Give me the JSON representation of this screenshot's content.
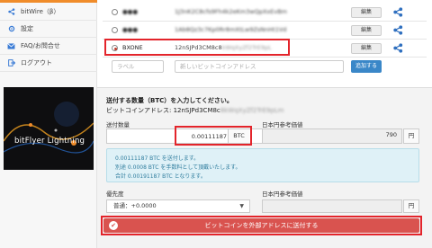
{
  "sidebar": {
    "items": [
      {
        "label": "bitWire（β）",
        "icon": "share-icon"
      },
      {
        "label": "設定",
        "icon": "gear-icon"
      },
      {
        "label": "FAQ/お問合せ",
        "icon": "mail-icon"
      },
      {
        "label": "ログアウト",
        "icon": "logout-icon"
      }
    ],
    "banner_text": "bitFlyer Lightning"
  },
  "address_book": {
    "rows": [
      {
        "label": "●●●",
        "address": "1J3nK2C8cfs9Fh4k2eKm3wQpXxEvBm",
        "edit_label": "編集",
        "selected": false
      },
      {
        "label": "●●●",
        "address": "1Ab8Qz3c7Kp0Rr8mXtLw9ZsNnHt1Vd",
        "edit_label": "編集",
        "selected": false
      },
      {
        "label": "BXONE",
        "address": "12nSJPd3CM8c8",
        "address_blurred": "kWqXyZf2TrE9pL",
        "edit_label": "編集",
        "selected": true
      }
    ],
    "new_label_placeholder": "ラベル",
    "new_address_placeholder": "新しいビットコインアドレス",
    "add_button": "追加する"
  },
  "send": {
    "title": "送付する数量（BTC）を入力してください。",
    "address_line_prefix": "ビットコインアドレス: 12nSJPd3CM8c",
    "address_line_blurred": "8kWqXyZf2TrE9pLm",
    "amount_label": "送付数量",
    "amount_value": "0.00111187",
    "amount_unit": "BTC",
    "jpy_label": "日本円参考価値",
    "jpy_value": "790",
    "jpy_unit": "円",
    "info_lines": [
      "0.00111187 BTC を送付します。",
      "別途 0.0008 BTC を手数料として頂戴いたします。",
      "合計 0.00191187 BTC となります。"
    ],
    "priority_label": "優先度",
    "priority_value": "普通：+0.0000",
    "fee_label": "日本円参考価値",
    "fee_unit": "円",
    "send_button": "ビットコインを外部アドレスに送付する"
  },
  "colors": {
    "accent": "#3a87c8",
    "danger": "#d9534f",
    "highlight": "#e3242b"
  }
}
